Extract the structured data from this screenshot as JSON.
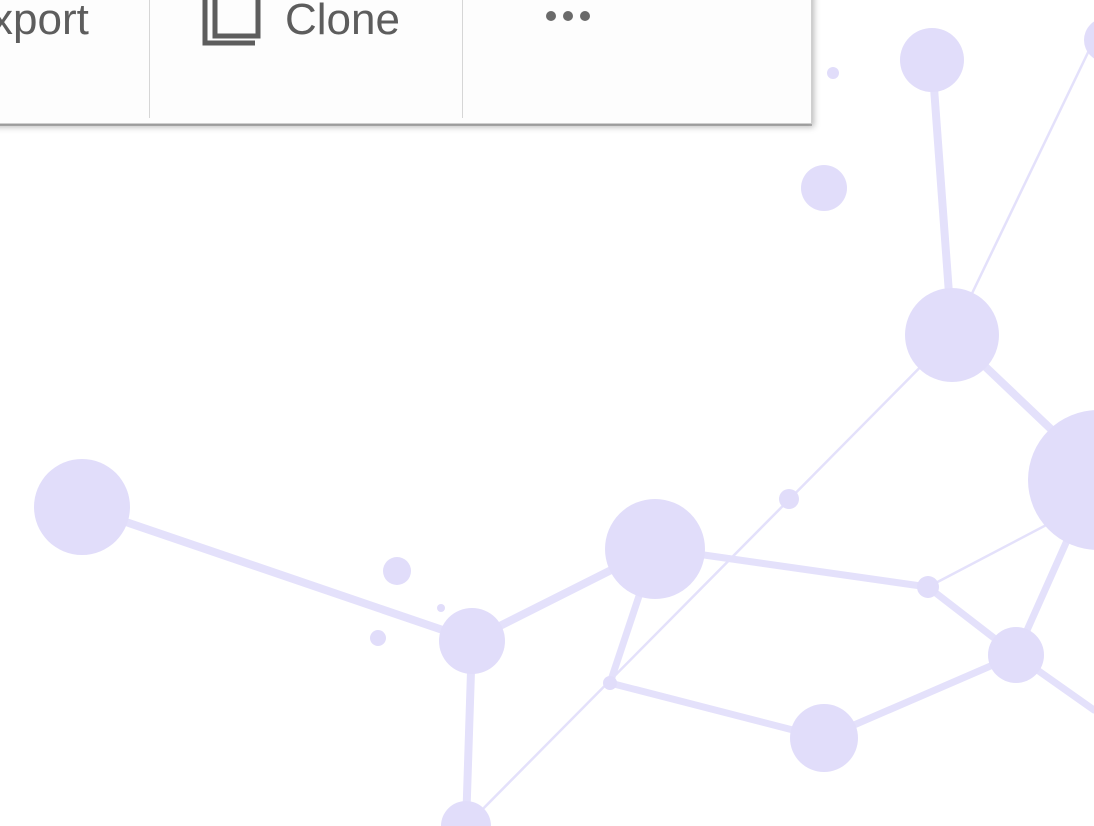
{
  "toolbar": {
    "export_label": "xport",
    "clone_label": "Clone",
    "more_icon": "more-horizontal-icon",
    "clone_icon": "clone-icon",
    "text_color": "#5d5d5d"
  },
  "background": {
    "decoration": "network-graph",
    "node_color": "#e1ddfa",
    "line_color": "#e4e1fb"
  }
}
